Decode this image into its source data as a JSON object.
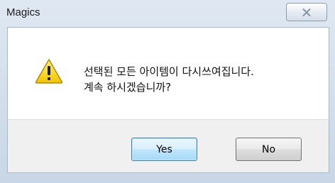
{
  "window": {
    "title": "Magics"
  },
  "titlebar": {
    "close_icon": "close-x-icon"
  },
  "dialog": {
    "icon": "warning-icon",
    "message_line1": "선택된 모든 아이템이 다시쓰여집니다.",
    "message_line2": "계속 하시겠습니까?"
  },
  "buttons": {
    "yes_label": "Yes",
    "no_label": "No"
  },
  "colors": {
    "window_frame": "#c8d6e6",
    "content_bg": "#ffffff",
    "button_bar_bg": "#f0f0f0",
    "default_button_border": "#3c7fb1",
    "warning_yellow": "#f7d21c"
  }
}
